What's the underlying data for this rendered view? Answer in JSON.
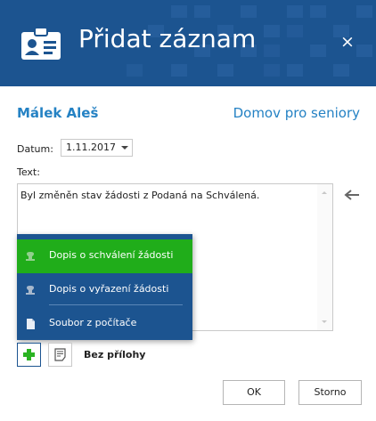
{
  "dialog": {
    "title": "Přidat záznam",
    "close_symbol": "×",
    "header_icon": "id-card-icon",
    "header_color": "#1c5490"
  },
  "record": {
    "person_name": "Málek Aleš",
    "facility": "Domov pro seniory",
    "accent_color": "#2582c4"
  },
  "form": {
    "date_label": "Datum:",
    "date_value": "1.11.2017",
    "text_label": "Text:",
    "text_value": "Byl změněn stav žádosti z Podaná na Schválená."
  },
  "attach_menu": {
    "items": [
      {
        "label": "Dopis o schválení žádosti",
        "icon": "document-stamp-icon",
        "active": true
      },
      {
        "label": "Dopis o vyřazení žádosti",
        "icon": "document-stamp-icon",
        "active": false
      },
      {
        "label": "Soubor z počítače",
        "icon": "file-icon",
        "active": false
      }
    ],
    "active_color": "#20ad1a",
    "background_color": "#1c5490"
  },
  "attachments": {
    "add_icon": "plus-icon",
    "note_icon": "note-icon",
    "status": "Bez přílohy"
  },
  "actions": {
    "ok_label": "OK",
    "cancel_label": "Storno"
  }
}
